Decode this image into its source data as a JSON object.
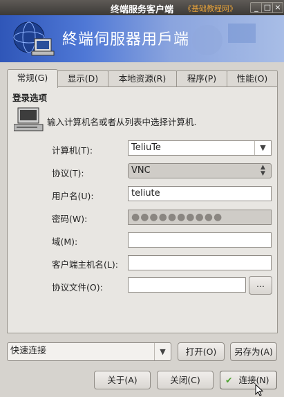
{
  "window": {
    "title": "终端服务客户端",
    "watermark": "《基础教程网》",
    "minimize": "_",
    "maximize": "□",
    "close": "×"
  },
  "banner": {
    "text": "終端伺服器用戶端"
  },
  "tabs": [
    {
      "label": "常规(G)",
      "active": true
    },
    {
      "label": "显示(D)"
    },
    {
      "label": "本地资源(R)"
    },
    {
      "label": "程序(P)"
    },
    {
      "label": "性能(O)"
    }
  ],
  "login": {
    "group_title": "登录选项",
    "description": "输入计算机名或者从列表中选择计算机.",
    "computer_label": "计算机(T):",
    "computer_value": "TeliuTe",
    "protocol_label": "协议(T):",
    "protocol_value": "VNC",
    "username_label": "用户名(U):",
    "username_value": "teliute",
    "password_label": "密码(W):",
    "password_mask": "●●●●●●●●●●",
    "domain_label": "域(M):",
    "domain_value": "",
    "client_host_label": "客户端主机名(L):",
    "client_host_value": "",
    "protocol_file_label": "协议文件(O):",
    "protocol_file_value": "",
    "browse_label": "..."
  },
  "quick": {
    "value": "快速连接",
    "open_label": "打开(O)",
    "save_as_label": "另存为(A)"
  },
  "footer": {
    "about_label": "关于(A)",
    "close_label": "关闭(C)",
    "connect_label": "连接(N)"
  },
  "colors": {
    "banner": "#4f78d6",
    "titlebar": "#3c3a37",
    "watermark": "#e8a33a"
  }
}
